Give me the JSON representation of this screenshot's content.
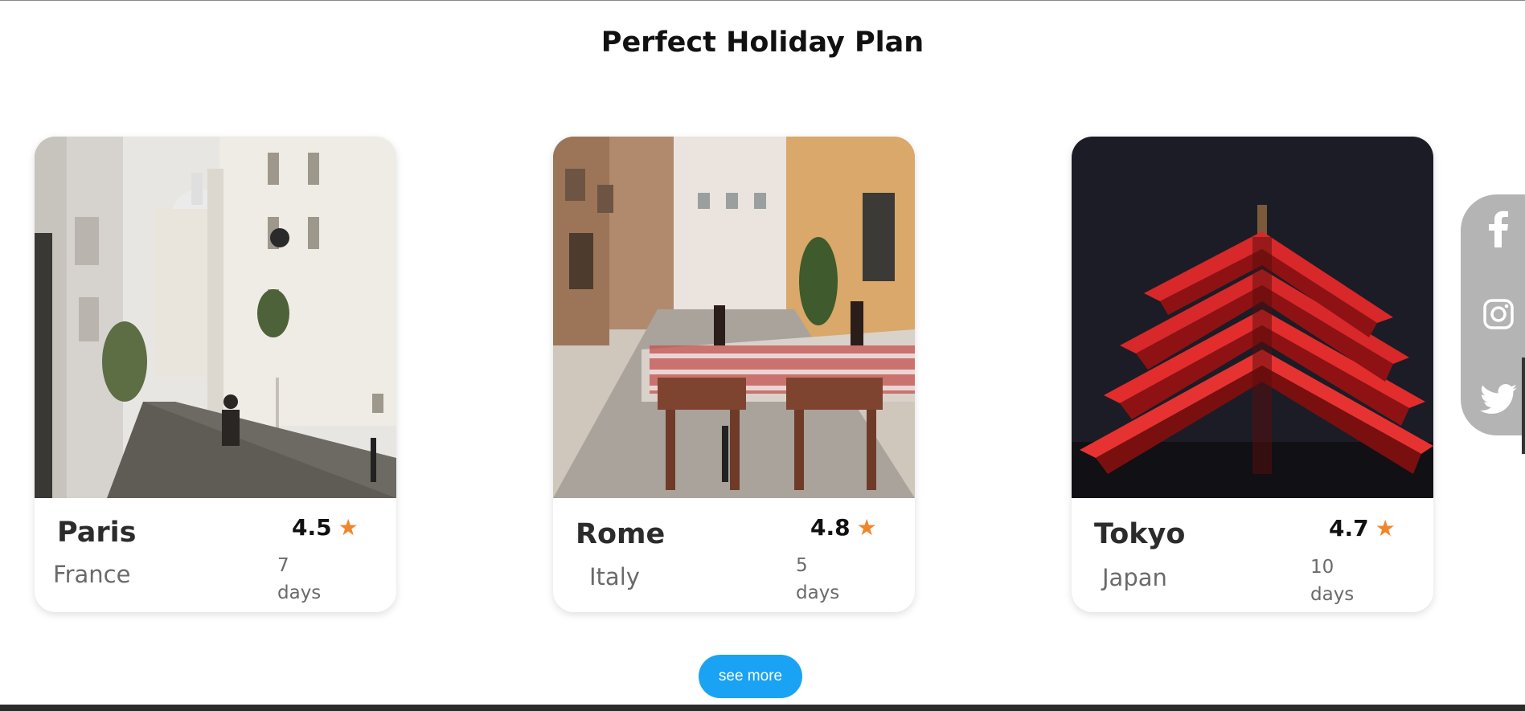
{
  "page": {
    "title": "Perfect Holiday Plan"
  },
  "cards": [
    {
      "city": "Paris",
      "country": "France",
      "rating": "4.5",
      "duration_number": "7",
      "duration_unit": "days",
      "image": "paris-street-photo"
    },
    {
      "city": "Rome",
      "country": "Italy",
      "rating": "4.8",
      "duration_number": "5",
      "duration_unit": "days",
      "image": "rome-cafe-photo"
    },
    {
      "city": "Tokyo",
      "country": "Japan",
      "rating": "4.7",
      "duration_number": "10",
      "duration_unit": "days",
      "image": "tokyo-pagoda-photo"
    }
  ],
  "rating_icon": "star-icon",
  "see_more": {
    "label": "see more"
  },
  "social": {
    "icons": [
      "facebook-icon",
      "instagram-icon",
      "twitter-icon"
    ]
  },
  "colors": {
    "accent": "#1aa3f4",
    "star": "#f0862a",
    "social_bar": "#b4b4b4"
  }
}
